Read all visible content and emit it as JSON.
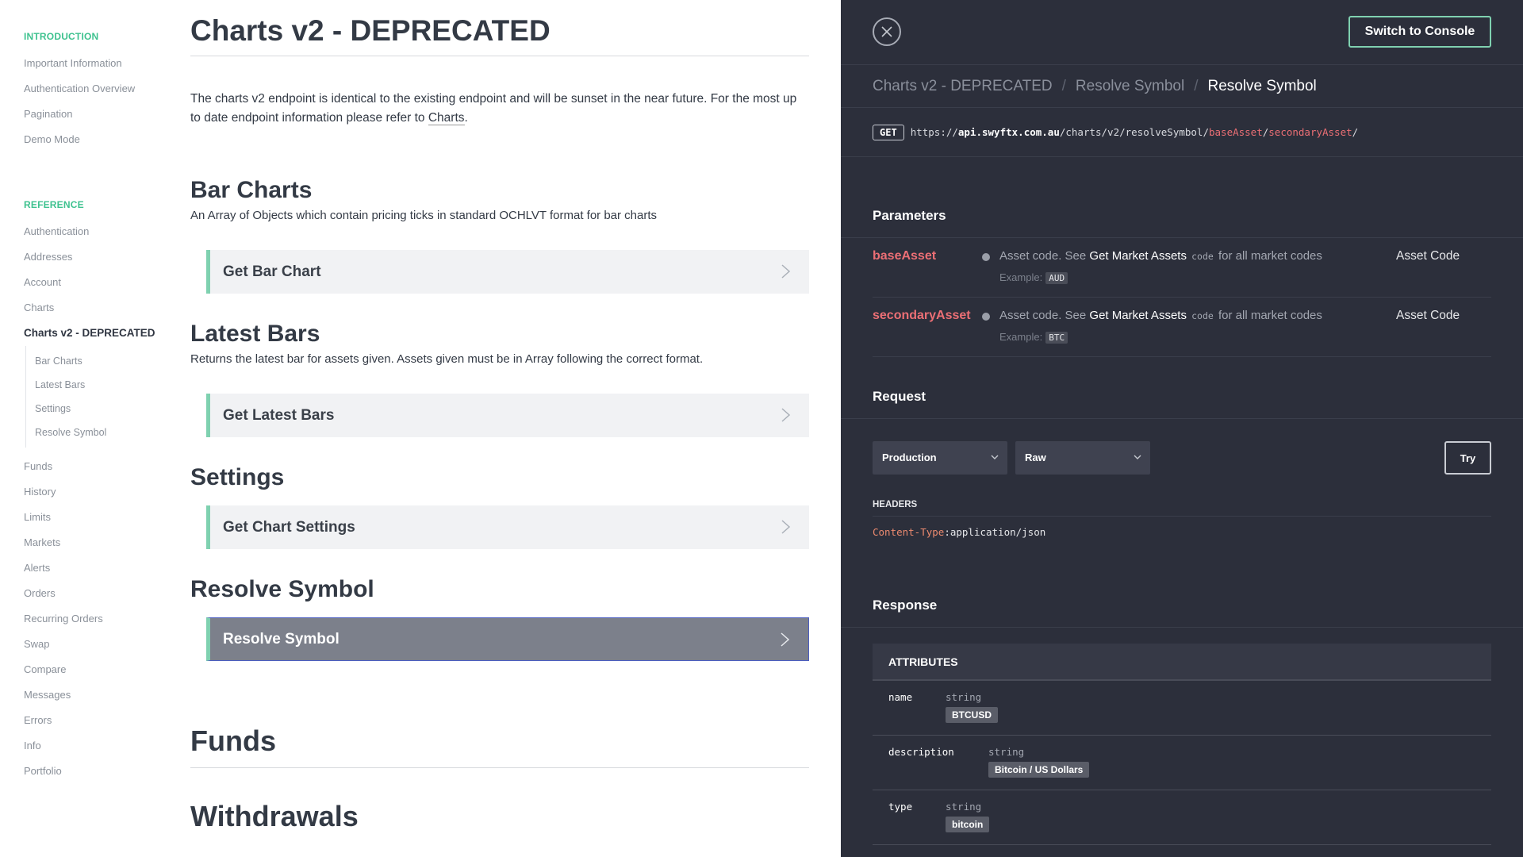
{
  "sidebar": {
    "intro_heading": "INTRODUCTION",
    "intro_items": [
      "Important Information",
      "Authentication Overview",
      "Pagination",
      "Demo Mode"
    ],
    "reference_heading": "REFERENCE",
    "ref_items": [
      "Authentication",
      "Addresses",
      "Account",
      "Charts"
    ],
    "active_item": "Charts v2 - DEPRECATED",
    "sub_items": [
      "Bar Charts",
      "Latest Bars",
      "Settings",
      "Resolve Symbol"
    ],
    "more_items": [
      "Funds",
      "History",
      "Limits",
      "Markets",
      "Alerts",
      "Orders",
      "Recurring Orders",
      "Swap",
      "Compare",
      "Messages",
      "Errors",
      "Info",
      "Portfolio"
    ]
  },
  "main": {
    "title": "Charts v2 - DEPRECATED",
    "intro_text": "The charts v2 endpoint is identical to the existing endpoint and will be sunset in the near future. For the most up to date endpoint information please refer to ",
    "intro_link": "Charts",
    "intro_end": ".",
    "sections": [
      {
        "title": "Bar Charts",
        "desc": "An Array of Objects which contain pricing ticks in standard OCHLVT format for bar charts",
        "endpoint": "Get Bar Chart"
      },
      {
        "title": "Latest Bars",
        "desc": "Returns the latest bar for assets given. Assets given must be in Array following the correct format.",
        "endpoint": "Get Latest Bars"
      },
      {
        "title": "Settings",
        "desc": "",
        "endpoint": "Get Chart Settings"
      },
      {
        "title": "Resolve Symbol",
        "desc": "",
        "endpoint": "Resolve Symbol"
      }
    ],
    "next_title": "Funds",
    "partial_title": "Withdrawals"
  },
  "panel": {
    "console_button": "Switch to Console",
    "breadcrumb": [
      "Charts v2 - DEPRECATED",
      "Resolve Symbol",
      "Resolve Symbol"
    ],
    "method": "GET",
    "url_scheme": "https://",
    "url_host": "api.swyftx.com.au",
    "url_path": "/charts/v2/resolveSymbol/",
    "url_param1": "baseAsset",
    "url_sep": "/",
    "url_param2": "secondaryAsset",
    "url_end": "/",
    "parameters_heading": "Parameters",
    "parameters": [
      {
        "name": "baseAsset",
        "desc_pre": "Asset code. See ",
        "desc_link": "Get Market Assets",
        "desc_code": "code",
        "desc_post": " for all market codes",
        "example_label": "Example:",
        "example": "AUD",
        "type": "Asset Code"
      },
      {
        "name": "secondaryAsset",
        "desc_pre": "Asset code. See ",
        "desc_link": "Get Market Assets",
        "desc_code": "code",
        "desc_post": " for all market codes",
        "example_label": "Example:",
        "example": "BTC",
        "type": "Asset Code"
      }
    ],
    "request_heading": "Request",
    "env_select": "Production",
    "format_select": "Raw",
    "try_button": "Try",
    "headers_label": "HEADERS",
    "header_key": "Content-Type",
    "header_sep": ":",
    "header_value": "application/json",
    "response_heading": "Response",
    "attributes_heading": "ATTRIBUTES",
    "attributes": [
      {
        "name": "name",
        "type": "string",
        "value": "BTCUSD"
      },
      {
        "name": "description",
        "type": "string",
        "value": "Bitcoin / US Dollars"
      },
      {
        "name": "type",
        "type": "string",
        "value": "bitcoin"
      }
    ]
  },
  "colors": {
    "accent_green": "#3ec28f",
    "param_red": "#ec6f75",
    "panel_bg": "#2c2f3b"
  }
}
